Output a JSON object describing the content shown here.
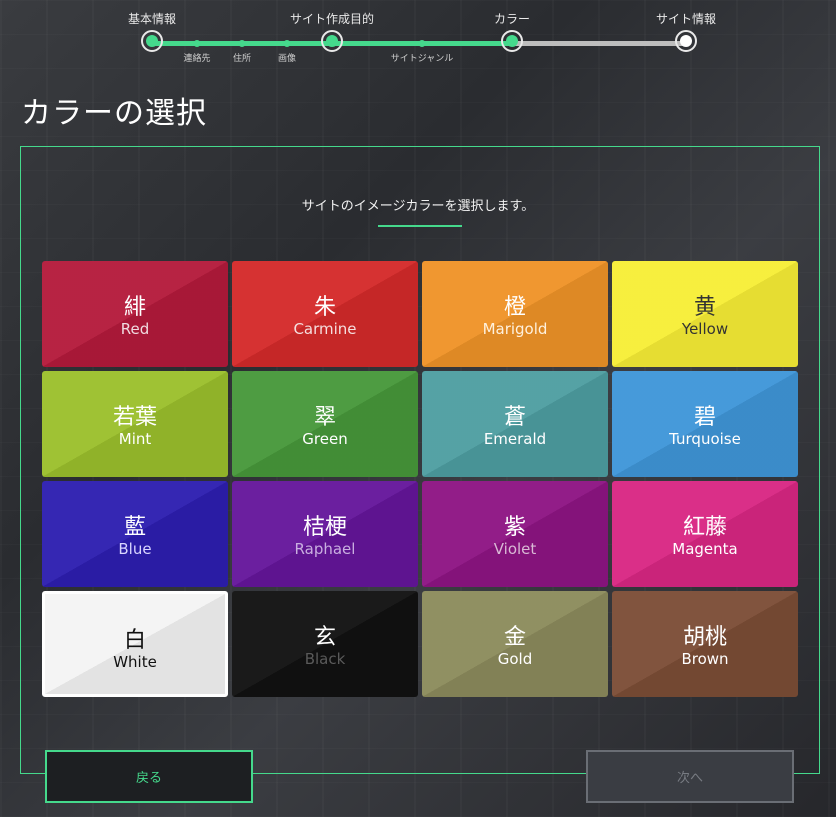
{
  "stepper": {
    "steps": [
      "基本情報",
      "サイト作成目的",
      "カラー",
      "サイト情報"
    ],
    "substeps": [
      "連絡先",
      "住所",
      "画像",
      "サイトジャンル"
    ]
  },
  "page": {
    "title": "カラーの選択",
    "description": "サイトのイメージカラーを選択します。"
  },
  "colors": [
    {
      "jp": "緋",
      "en": "Red",
      "bg": "#b41a3b",
      "fg": "#ffffff",
      "sub": "#f0dbe0"
    },
    {
      "jp": "朱",
      "en": "Carmine",
      "bg": "#d42a2a",
      "fg": "#ffffff",
      "sub": "#f5dede"
    },
    {
      "jp": "橙",
      "en": "Marigold",
      "bg": "#ef9328",
      "fg": "#ffffff",
      "sub": "#fff1dd"
    },
    {
      "jp": "黄",
      "en": "Yellow",
      "bg": "#f7ee36",
      "fg": "#333333",
      "sub": "#333333"
    },
    {
      "jp": "若葉",
      "en": "Mint",
      "bg": "#9bc02c",
      "fg": "#ffffff",
      "sub": "#ffffff"
    },
    {
      "jp": "翠",
      "en": "Green",
      "bg": "#47983a",
      "fg": "#ffffff",
      "sub": "#ffffff"
    },
    {
      "jp": "蒼",
      "en": "Emerald",
      "bg": "#4e9ea1",
      "fg": "#ffffff",
      "sub": "#ffffff"
    },
    {
      "jp": "碧",
      "en": "Turquoise",
      "bg": "#3f96d8",
      "fg": "#ffffff",
      "sub": "#ffffff"
    },
    {
      "jp": "藍",
      "en": "Blue",
      "bg": "#2d1eb0",
      "fg": "#ffffff",
      "sub": "#d9d5ff"
    },
    {
      "jp": "桔梗",
      "en": "Raphael",
      "bg": "#65169b",
      "fg": "#ffffff",
      "sub": "#c9aee0"
    },
    {
      "jp": "紫",
      "en": "Violet",
      "bg": "#8e1483",
      "fg": "#ffffff",
      "sub": "#d9b9d5"
    },
    {
      "jp": "紅藤",
      "en": "Magenta",
      "bg": "#d92783",
      "fg": "#ffffff",
      "sub": "#ffffff"
    },
    {
      "jp": "白",
      "en": "White",
      "bg": "#f4f4f4",
      "fg": "#111111",
      "sub": "#111111"
    },
    {
      "jp": "玄",
      "en": "Black",
      "bg": "#111111",
      "fg": "#ffffff",
      "sub": "#5a5a5a"
    },
    {
      "jp": "金",
      "en": "Gold",
      "bg": "#8c8b5c",
      "fg": "#ffffff",
      "sub": "#ffffff"
    },
    {
      "jp": "胡桃",
      "en": "Brown",
      "bg": "#7c4d36",
      "fg": "#ffffff",
      "sub": "#ffffff"
    }
  ],
  "buttons": {
    "back": "戻る",
    "next": "次へ"
  },
  "theme": {
    "accent": "#45d98c"
  }
}
